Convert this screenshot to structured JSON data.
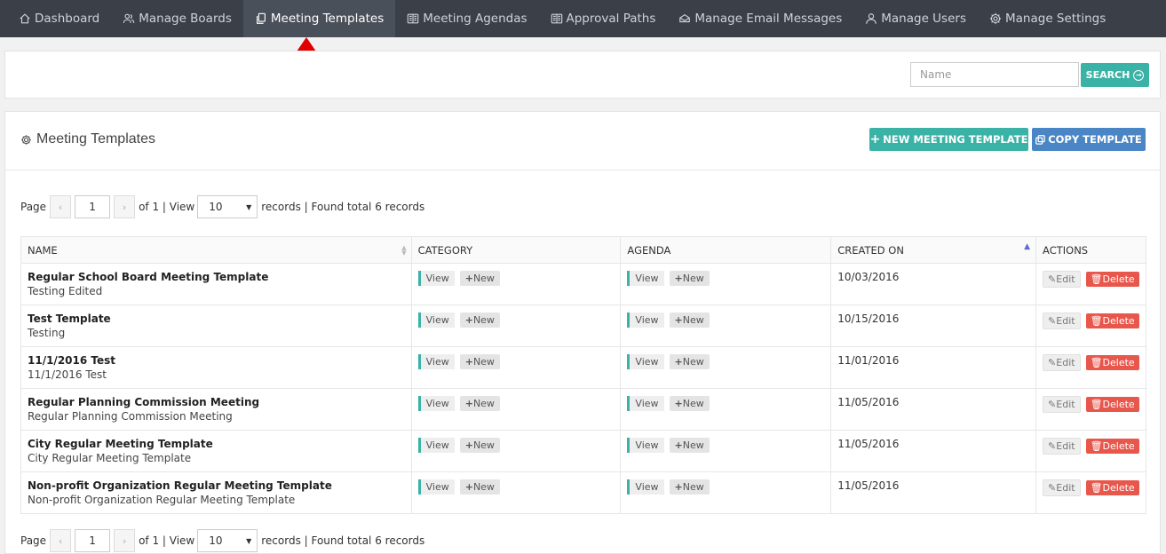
{
  "nav": {
    "items": [
      {
        "label": "Dashboard",
        "icon": "home-icon"
      },
      {
        "label": "Manage Boards",
        "icon": "users-icon"
      },
      {
        "label": "Meeting Templates",
        "icon": "copy-icon",
        "active": true
      },
      {
        "label": "Meeting Agendas",
        "icon": "book-icon"
      },
      {
        "label": "Approval Paths",
        "icon": "book-icon"
      },
      {
        "label": "Manage Email Messages",
        "icon": "email-icon"
      },
      {
        "label": "Manage Users",
        "icon": "user-icon"
      },
      {
        "label": "Manage Settings",
        "icon": "gear-icon"
      }
    ]
  },
  "search": {
    "placeholder": "Name",
    "value": "",
    "button_label": "SEARCH"
  },
  "panel": {
    "title": "Meeting Templates",
    "new_button_label": "NEW MEETING TEMPLATE",
    "copy_button_label": "COPY TEMPLATE"
  },
  "pager": {
    "page_label": "Page",
    "prev": "‹",
    "next": "›",
    "page_value": "1",
    "of_text": "of 1 | View",
    "view_value": "10",
    "records_text": "records | Found total 6 records"
  },
  "table": {
    "headers": {
      "name": "NAME",
      "category": "CATEGORY",
      "agenda": "AGENDA",
      "created_on": "CREATED ON",
      "actions": "ACTIONS"
    },
    "view_label": "View",
    "new_label": "New",
    "edit_label": "Edit",
    "delete_label": "Delete",
    "rows": [
      {
        "name": "Regular School Board Meeting Template",
        "description": "Testing Edited",
        "created_on": "10/03/2016"
      },
      {
        "name": "Test Template",
        "description": "Testing",
        "created_on": "10/15/2016"
      },
      {
        "name": "11/1/2016 Test",
        "description": "11/1/2016 Test",
        "created_on": "11/01/2016"
      },
      {
        "name": "Regular Planning Commission Meeting",
        "description": "Regular Planning Commission Meeting",
        "created_on": "11/05/2016"
      },
      {
        "name": "City Regular Meeting Template",
        "description": "City Regular Meeting Template",
        "created_on": "11/05/2016"
      },
      {
        "name": "Non-profit Organization Regular Meeting Template",
        "description": "Non-profit Organization Regular Meeting Template",
        "created_on": "11/05/2016"
      }
    ]
  },
  "colors": {
    "nav_bg": "#3a3f48",
    "teal": "#3ab3a6",
    "blue": "#4a86c5",
    "red": "#e8574c",
    "annotation_arrow": "#e00000"
  }
}
